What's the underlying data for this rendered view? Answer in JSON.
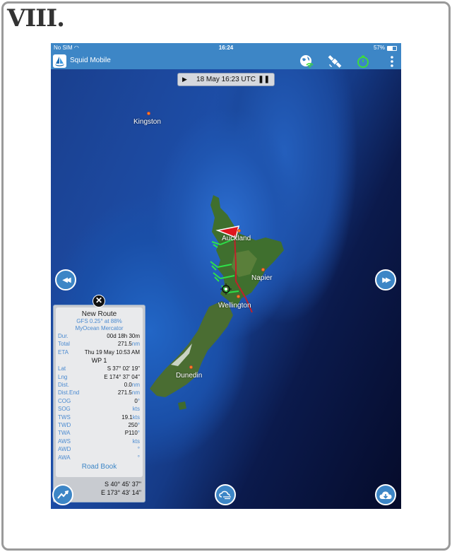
{
  "step_label": "VIII.",
  "statusbar": {
    "carrier": "No SIM",
    "time": "16:24",
    "battery": "57%",
    "battery_level": 0.57
  },
  "appbar": {
    "title": "Squid Mobile",
    "icons": [
      "globe-wifi-icon",
      "satellite-icon",
      "stopwatch-icon",
      "more-vertical-icon"
    ],
    "stopwatch_color": "#3ddc3d"
  },
  "time_control": {
    "play_glyph": "▶",
    "datetime": "18 May 16:23 UTC",
    "pause_glyph": "❚❚"
  },
  "map": {
    "cities": [
      {
        "name": "Kingston"
      },
      {
        "name": "Auckland"
      },
      {
        "name": "Napier"
      },
      {
        "name": "Wellington"
      },
      {
        "name": "Dunedin"
      }
    ],
    "route_color": "#c0202a",
    "flag_color": "#e0151c",
    "wind_barb_color": "#2ee04a"
  },
  "nav": {
    "rewind_glyph": "◀◀",
    "forward_glyph": "▶▶"
  },
  "route_panel": {
    "close_glyph": "✕",
    "title": "New Route",
    "model_line1": "GFS 0.25° at 88%",
    "model_line2": "MyOcean Mercator",
    "summary": [
      {
        "key": "Dur.",
        "value": "00d 18h 30m",
        "unit": ""
      },
      {
        "key": "Total",
        "value": "271.5",
        "unit": "nm"
      },
      {
        "key": "ETA",
        "value": "Thu 19 May 10:53 AM",
        "unit": ""
      }
    ],
    "waypoint_title": "WP 1",
    "waypoint": [
      {
        "key": "Lat",
        "value": "S 37° 02' 19\"",
        "unit": ""
      },
      {
        "key": "Lng",
        "value": "E 174° 37' 04\"",
        "unit": ""
      },
      {
        "key": "Dist.",
        "value": "0.0",
        "unit": "nm"
      },
      {
        "key": "Dist.End",
        "value": "271.5",
        "unit": "nm"
      },
      {
        "key": "COG",
        "value": "0",
        "unit": "°"
      },
      {
        "key": "SOG",
        "value": "",
        "unit": "kts"
      },
      {
        "key": "TWS",
        "value": "19.1",
        "unit": "kts"
      },
      {
        "key": "TWD",
        "value": "250",
        "unit": "°"
      },
      {
        "key": "TWA",
        "value": "P110",
        "unit": "°"
      },
      {
        "key": "AWS",
        "value": "",
        "unit": "kts"
      },
      {
        "key": "AWD",
        "value": "",
        "unit": "°"
      },
      {
        "key": "AWA",
        "value": "",
        "unit": "°"
      }
    ],
    "road_book_label": "Road Book",
    "cursor_lat": "S 40° 45' 37\"",
    "cursor_lng": "E 173° 43' 14\""
  },
  "bottom_buttons": [
    "chart-trend-icon",
    "cloud-weather-icon",
    "cloud-download-icon"
  ]
}
